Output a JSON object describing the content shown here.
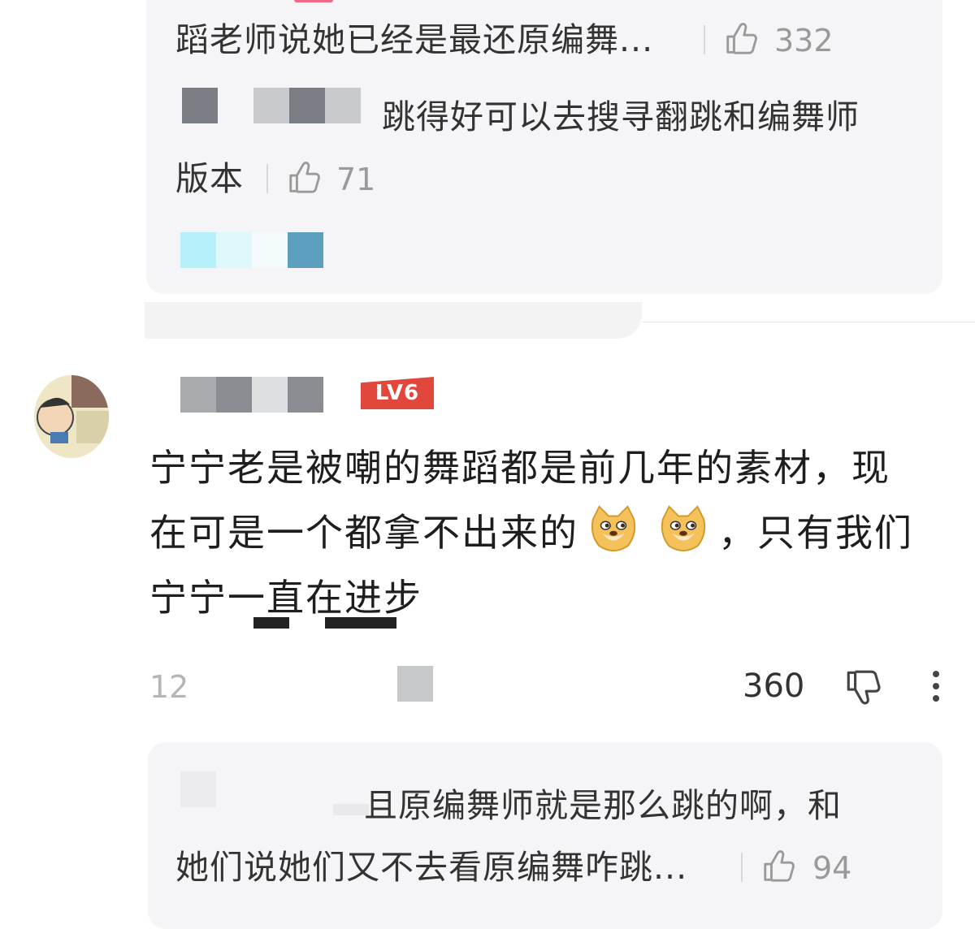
{
  "top_reply_box": {
    "reply1": {
      "text": "蹈老师说她已经是最还原编舞...",
      "likes": "332"
    },
    "reply2": {
      "text_line1": "跳得好可以去搜寻翻跳和编舞师",
      "text_line2": "版本",
      "likes": "71"
    }
  },
  "comment": {
    "level_badge": "LV6",
    "text_line1": "宁宁老是被嘲的舞蹈都是前几年的素材，现",
    "text_line2_a": "在可是一个都拿不出来的",
    "text_line2_b": "，只有我们",
    "text_line3": "宁宁一直在进步",
    "time": "12",
    "likes": "360"
  },
  "bottom_reply_box": {
    "reply1": {
      "text_line1": "且原编舞师就是那么跳的啊，和",
      "text_line2": "她们说她们又不去看原编舞咋跳...",
      "likes": "94"
    }
  },
  "icons": {
    "like": "thumbs-up-icon",
    "dislike": "thumbs-down-icon",
    "more": "more-vertical-icon",
    "emoji": "doge-emoji"
  },
  "colors": {
    "reply_bg": "#f5f5f7",
    "level_badge": "#e2473c",
    "text_dark": "#1e1e1e",
    "text_muted": "#9a9a9a"
  }
}
